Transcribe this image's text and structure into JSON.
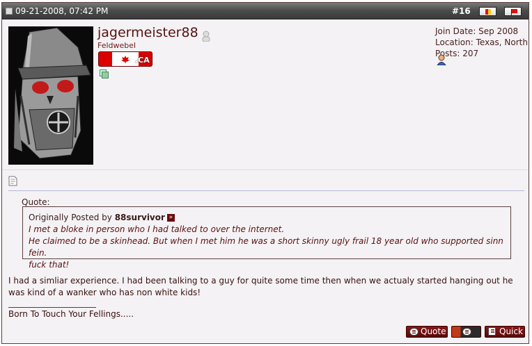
{
  "header": {
    "date": "09-21-2008, 07:42 PM",
    "post_number": "#16"
  },
  "user": {
    "name": "jagermeister88",
    "title": "Feldwebel",
    "flag_text": ".CA"
  },
  "info": {
    "join_date": "Join Date: Sep 2008",
    "location": "Location: Texas, North",
    "posts": "Posts: 207"
  },
  "quote": {
    "label": "Quote:",
    "originally_posted_by": "Originally Posted by",
    "author": "88survivor",
    "lines": [
      "I met a bloke in person who I had talked to over the internet.",
      "He claimed to be a skinhead. But when I met him he was a short skinny ugly frail 18 year old who supported sinn fein.",
      "fuck that!"
    ]
  },
  "message": "I had a simliar experience. I had been talking to a guy for quite some time then when we actualy started hanging out he was kind of a wanker who has non white kids!",
  "signature": "Born To Touch Your Fellings.....",
  "buttons": {
    "quote": "Quote",
    "quick": "Quick"
  }
}
